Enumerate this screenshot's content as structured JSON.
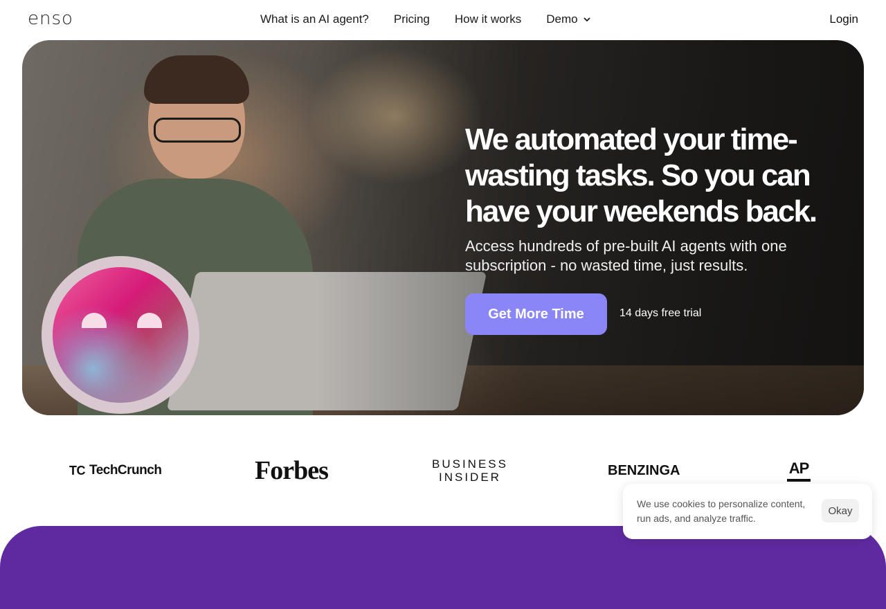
{
  "header": {
    "logo": "enso",
    "nav": [
      "What is an AI agent?",
      "Pricing",
      "How it works"
    ],
    "demo_label": "Demo",
    "login_label": "Login"
  },
  "hero": {
    "title": "We automated your time-wasting tasks. So you can have your weekends back.",
    "subtitle": "Access hundreds of pre-built AI agents with one subscription - no wasted time, just results.",
    "cta_label": "Get More Time",
    "trial_note": "14 days free trial"
  },
  "press_logos": {
    "techcrunch_mark": "TC",
    "techcrunch": "TechCrunch",
    "forbes": "Forbes",
    "business_insider_line1": "BUSINESS",
    "business_insider_line2": "INSIDER",
    "benzinga": "BENZINGA",
    "ap": "AP"
  },
  "cookie": {
    "text": "We use cookies to personalize content, run ads, and analyze traffic.",
    "button_label": "Okay"
  },
  "colors": {
    "cta": "#8b86f7",
    "band": "#5f2aa0"
  }
}
